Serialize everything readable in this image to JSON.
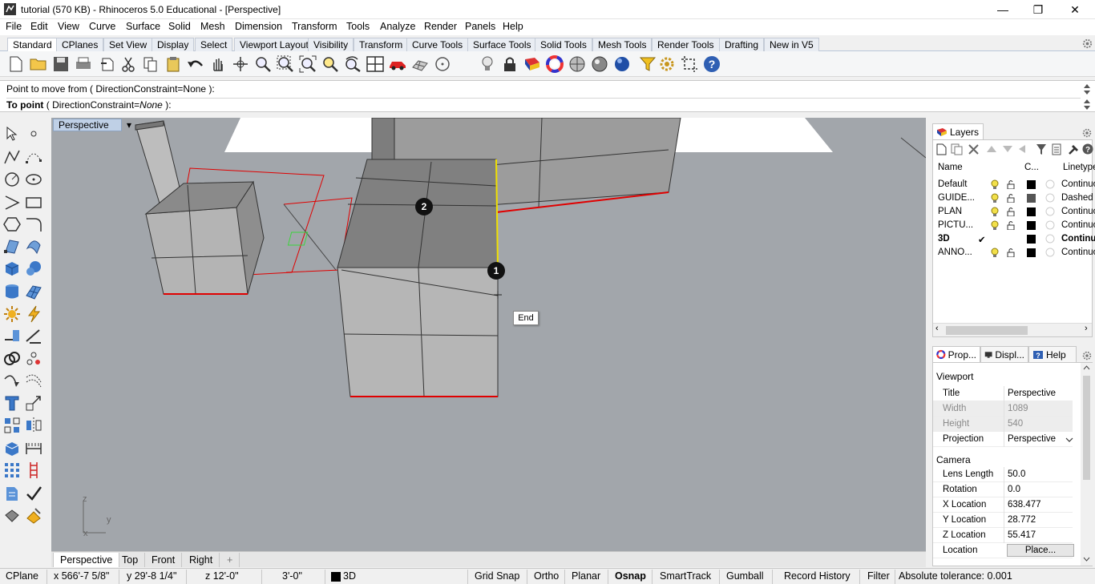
{
  "window": {
    "title": "tutorial (570 KB) - Rhinoceros 5.0 Educational - [Perspective]",
    "minimize": "—",
    "restore": "❐",
    "close": "✕"
  },
  "menu": [
    "File",
    "Edit",
    "View",
    "Curve",
    "Surface",
    "Solid",
    "Mesh",
    "Dimension",
    "Transform",
    "Tools",
    "Analyze",
    "Render",
    "Panels",
    "Help"
  ],
  "toolbar_tabs": [
    "Standard",
    "CPlanes",
    "Set View",
    "Display",
    "Select",
    "Viewport Layout",
    "Visibility",
    "Transform",
    "Curve Tools",
    "Surface Tools",
    "Solid Tools",
    "Mesh Tools",
    "Render Tools",
    "Drafting",
    "New in V5"
  ],
  "toolbar_active_tab": "Standard",
  "toolbar_icons": [
    "new-file-icon",
    "open-file-icon",
    "save-icon",
    "print-icon",
    "import-icon",
    "cut-icon",
    "copy-icon",
    "paste-icon",
    "undo-icon",
    "pan-hand-icon",
    "rotate-view-icon",
    "zoom-icon",
    "zoom-window-icon",
    "zoom-extents-icon",
    "zoom-selected-icon",
    "rotate-icon",
    "four-viewports-icon",
    "car-icon",
    "mesh-icon",
    "circle-icon",
    "light-bulb-icon",
    "lock-icon",
    "materials-icon",
    "color-wheel-icon",
    "shaded-sphere-icon",
    "rendered-sphere-icon",
    "blue-sphere-icon",
    "filter-icon",
    "gear-icon",
    "crop-icon",
    "help-icon"
  ],
  "command": {
    "history": "Point to move from ( DirectionConstraint=None ):",
    "prompt_label": "To point",
    "prompt_open": " ( ",
    "prompt_option": "DirectionConstraint",
    "prompt_eq": "=",
    "prompt_value": "None",
    "prompt_close": " ):"
  },
  "viewport": {
    "title": "Perspective",
    "dropdown": "▾",
    "snap_tooltip": "End",
    "marker_1": "1",
    "marker_2": "2",
    "axis_z": "z",
    "axis_y": "y",
    "axis_x": "x"
  },
  "view_tabs": [
    "Perspective",
    "Top",
    "Front",
    "Right"
  ],
  "view_tab_add": "+",
  "status": {
    "cplane": "CPlane",
    "x": "x 566'-7 5/8\"",
    "y": "y 29'-8 1/4\"",
    "z": "z 12'-0\"",
    "dist": "3'-0\"",
    "layer": "3D",
    "grid_snap": "Grid Snap",
    "ortho": "Ortho",
    "planar": "Planar",
    "osnap": "Osnap",
    "smarttrack": "SmartTrack",
    "gumball": "Gumball",
    "record_history": "Record History",
    "filter": "Filter",
    "tolerance": "Absolute tolerance: 0.001"
  },
  "layers_panel": {
    "tab": "Layers",
    "columns": {
      "name": "Name",
      "color": "C...",
      "linetype": "Linetype"
    },
    "rows": [
      {
        "name": "Default",
        "linetype": "Continuo",
        "current": false,
        "color": "#000000"
      },
      {
        "name": "GUIDE...",
        "linetype": "Dashed",
        "current": false,
        "color": "#555555"
      },
      {
        "name": "PLAN",
        "linetype": "Continuo",
        "current": false,
        "color": "#000000"
      },
      {
        "name": "PICTU...",
        "linetype": "Continuo",
        "current": false,
        "color": "#000000"
      },
      {
        "name": "3D",
        "linetype": "Continu",
        "current": true,
        "color": "#000000"
      },
      {
        "name": "ANNO...",
        "linetype": "Continuo",
        "current": false,
        "color": "#000000"
      }
    ],
    "checkmark": "✔"
  },
  "properties_panel": {
    "tabs": [
      "Prop...",
      "Displ...",
      "Help"
    ],
    "viewport_section": "Viewport",
    "camera_section": "Camera",
    "viewport_rows": [
      {
        "key": "Title",
        "value": "Perspective",
        "disabled": false
      },
      {
        "key": "Width",
        "value": "1089",
        "disabled": true
      },
      {
        "key": "Height",
        "value": "540",
        "disabled": true
      },
      {
        "key": "Projection",
        "value": "Perspective",
        "disabled": false
      }
    ],
    "camera_rows": [
      {
        "key": "Lens Length",
        "value": "50.0"
      },
      {
        "key": "Rotation",
        "value": "0.0"
      },
      {
        "key": "X Location",
        "value": "638.477"
      },
      {
        "key": "Y Location",
        "value": "28.772"
      },
      {
        "key": "Z Location",
        "value": "55.417"
      }
    ],
    "location_key": "Location",
    "place_button": "Place..."
  },
  "colors": {
    "viewport_bg": "#a2a6ab",
    "selected_edge": "#f0e000",
    "highlight_red": "#e00000"
  }
}
